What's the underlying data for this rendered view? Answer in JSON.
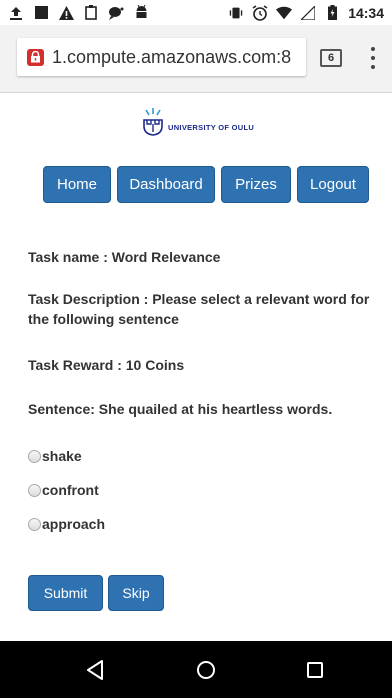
{
  "status_bar": {
    "time": "14:34",
    "left_icons": [
      "upload-icon",
      "stop-icon",
      "warning-icon",
      "clipboard-icon",
      "chat-icon",
      "android-icon"
    ],
    "right_icons": [
      "vibrate-icon",
      "alarm-icon",
      "wifi-icon",
      "signal-icon",
      "battery-icon"
    ]
  },
  "browser": {
    "url": "1.compute.amazonaws.com:8",
    "tab_count": "6"
  },
  "logo": {
    "text": "UNIVERSITY OF OULU"
  },
  "nav": {
    "home": "Home",
    "dashboard": "Dashboard",
    "prizes": "Prizes",
    "logout": "Logout"
  },
  "task": {
    "name": "Task name : Word Relevance",
    "description": "Task Description : Please select a relevant word for the following sentence",
    "reward": "Task Reward : 10 Coins",
    "sentence": "Sentence: She quailed at his heartless words."
  },
  "options": [
    "shake",
    "confront",
    "approach"
  ],
  "actions": {
    "submit": "Submit",
    "skip": "Skip"
  },
  "colors": {
    "button": "#2e72b1",
    "lock": "#d32f2f",
    "logo": "#1b2a8a"
  }
}
